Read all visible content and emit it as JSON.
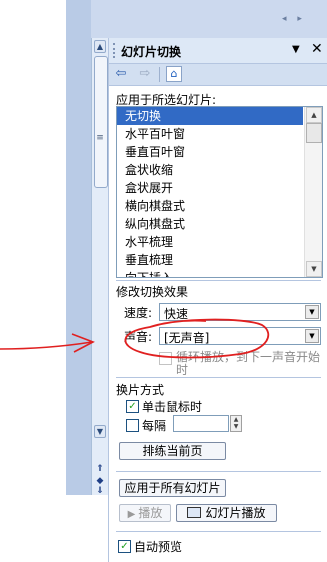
{
  "tab_arrows": "◂ ▸",
  "pane": {
    "title": "幻灯片切换",
    "menu_glyph": "▼",
    "close_glyph": "✕"
  },
  "nav": {
    "back_glyph": "⇦",
    "forward_glyph": "⇨",
    "home_glyph": "⌂"
  },
  "apply_section": {
    "label": "应用于所选幻灯片:",
    "items": [
      "无切换",
      "水平百叶窗",
      "垂直百叶窗",
      "盒状收缩",
      "盒状展开",
      "横向棋盘式",
      "纵向棋盘式",
      "水平梳理",
      "垂直梳理",
      "向下插入"
    ],
    "selected_index": 0
  },
  "modify_section": {
    "title": "修改切换效果",
    "speed_label": "速度:",
    "speed_value": "快速",
    "sound_label": "声音:",
    "sound_value": "[无声音]",
    "loop_label_line1": "循环播放，到下一声音开始",
    "loop_label_line2": "时",
    "loop_checked": false
  },
  "advance_section": {
    "title": "换片方式",
    "on_click_label": "单击鼠标时",
    "on_click_checked": true,
    "every_label": "每隔",
    "every_checked": false,
    "every_value": "",
    "apply_current_button": "排练当前页"
  },
  "apply_all_button": "应用于所有幻灯片",
  "play_button": "播放",
  "slideshow_button": "幻灯片播放",
  "auto_preview_label": "自动预览",
  "auto_preview_checked": true,
  "colors": {
    "selection": "#316ac5",
    "pane_header": "#dde8f6",
    "slide_area": "#b9cbe6",
    "annotation": "#e02020"
  }
}
